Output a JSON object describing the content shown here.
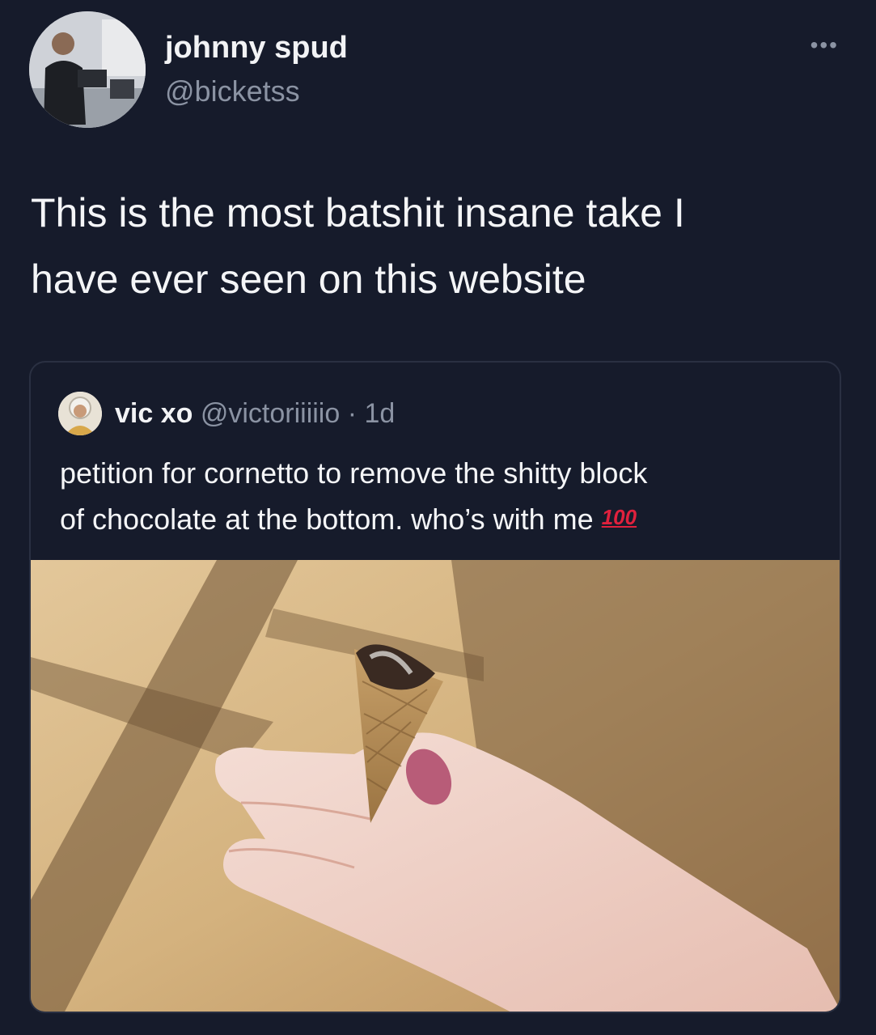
{
  "author": {
    "display_name": "johnny spud",
    "handle": "@bicketss"
  },
  "more_icon": "more-horizontal-icon",
  "tweet": {
    "text_line1": "This is the most batshit insane take I",
    "text_line2": "have ever seen on this website"
  },
  "quoted": {
    "display_name": "vic xo",
    "handle_time": "@victoriiiiio · 1d",
    "text_line1": "petition for cornetto to remove the shitty block",
    "text_line2": "of chocolate at the bottom. who’s with me",
    "emoji_label": "100"
  },
  "colors": {
    "background": "#161b2b",
    "text": "#f4f5f7",
    "muted": "#8b93a3",
    "border": "#2a3042",
    "emoji_red": "#e0213d"
  }
}
